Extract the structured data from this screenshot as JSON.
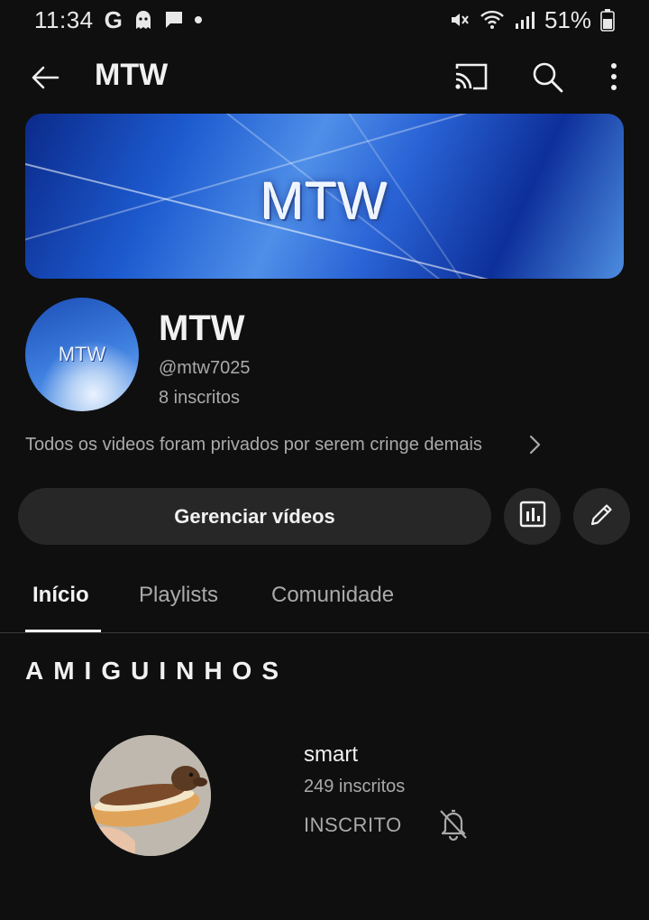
{
  "status_bar": {
    "time": "11:34",
    "g_label": "G",
    "battery": "51%",
    "icons": [
      "google-icon",
      "ghost-icon",
      "chat-icon",
      "mute-icon",
      "wifi-icon",
      "signal-icon",
      "battery-icon"
    ]
  },
  "app_bar": {
    "title": "MTW",
    "icons": [
      "back-arrow-icon",
      "cast-icon",
      "search-icon",
      "more-vert-icon"
    ]
  },
  "banner": {
    "text": "MTW"
  },
  "channel": {
    "avatar_text": "MTW",
    "name": "MTW",
    "handle": "@mtw7025",
    "subscribers": "8 inscritos",
    "description": "Todos os videos foram privados por serem cringe demais"
  },
  "actions": {
    "manage_label": "Gerenciar vídeos",
    "icons": [
      "analytics-icon",
      "edit-pencil-icon"
    ]
  },
  "tabs": [
    {
      "label": "Início",
      "active": true
    },
    {
      "label": "Playlists",
      "active": false
    },
    {
      "label": "Comunidade",
      "active": false
    }
  ],
  "section": {
    "title": "AMIGUINHOS",
    "channels": [
      {
        "name": "smart",
        "subscribers": "249 inscritos",
        "status": "INSCRITO"
      }
    ]
  },
  "colors": {
    "background": "#0f0f0f",
    "surface": "#272727",
    "text_primary": "#f1f1f1",
    "text_secondary": "#aaaaaa"
  }
}
